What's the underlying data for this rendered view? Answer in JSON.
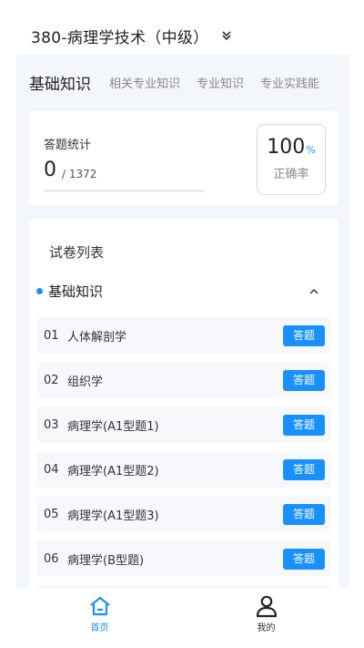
{
  "header": {
    "title": "380-病理学技术（中级）",
    "dropdown_icon": "double-chevron-down-icon"
  },
  "tabs": [
    "基础知识",
    "相关专业知识",
    "专业知识",
    "专业实践能"
  ],
  "stats": {
    "label": "答题统计",
    "answered": "0",
    "total": "/ 1372",
    "progress": 0,
    "rate_value": "100",
    "rate_unit": "%",
    "rate_label": "正确率"
  },
  "paper_list": {
    "title": "试卷列表",
    "section": "基础知识",
    "collapse_icon": "chevron-up-icon",
    "items": [
      {
        "index": "01",
        "name": "人体解剖学",
        "action": "答题"
      },
      {
        "index": "02",
        "name": "组织学",
        "action": "答题"
      },
      {
        "index": "03",
        "name": "病理学(A1型题1)",
        "action": "答题"
      },
      {
        "index": "04",
        "name": "病理学(A1型题2)",
        "action": "答题"
      },
      {
        "index": "05",
        "name": "病理学(A1型题3)",
        "action": "答题"
      },
      {
        "index": "06",
        "name": "病理学(B型题)",
        "action": "答题"
      }
    ]
  },
  "tabbar": [
    {
      "label": "首页",
      "icon": "home-icon",
      "active": true
    },
    {
      "label": "我的",
      "icon": "user-icon",
      "active": false
    }
  ],
  "colors": {
    "accent": "#1890ff",
    "background": "#f3f6fb"
  }
}
